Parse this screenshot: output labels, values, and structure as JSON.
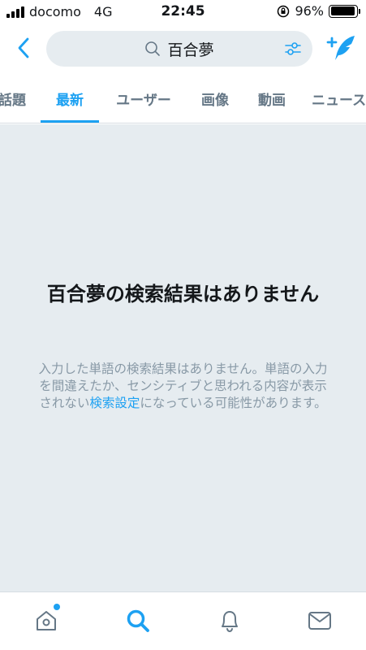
{
  "status_bar": {
    "carrier": "docomo",
    "network": "4G",
    "time": "22:45",
    "battery": "96%",
    "battery_level": 0.96
  },
  "search": {
    "query": "百合夢",
    "back_icon": "chevron-left-icon",
    "search_icon": "magnifier-icon",
    "filter_icon": "sliders-icon",
    "compose_icon": "compose-tweet-icon"
  },
  "tabs": [
    {
      "label": "話題",
      "active": false
    },
    {
      "label": "最新",
      "active": true
    },
    {
      "label": "ユーザー",
      "active": false
    },
    {
      "label": "画像",
      "active": false
    },
    {
      "label": "動画",
      "active": false
    },
    {
      "label": "ニュース",
      "active": false
    }
  ],
  "empty_state": {
    "title": "百合夢の検索結果はありません",
    "description_before": "入力した単語の検索結果はありません。単語の入力を間違えたか、センシティブと思われる内容が表示されない",
    "description_link": "検索設定",
    "description_after": "になっている可能性があります。"
  },
  "bottom_nav": {
    "items": [
      "home-icon",
      "search-icon",
      "notifications-icon",
      "messages-icon"
    ],
    "active": "search-icon"
  },
  "colors": {
    "accent": "#1da1f2",
    "background_gray": "#e6ecf0",
    "muted_text": "#8899a6"
  }
}
